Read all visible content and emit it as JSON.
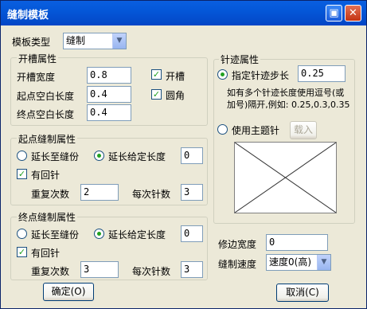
{
  "window": {
    "title": "缝制模板",
    "buttons": {
      "help": "▣",
      "close": "✕"
    }
  },
  "template_type": {
    "label": "模板类型",
    "value": "缝制"
  },
  "groove": {
    "title": "开槽属性",
    "width_label": "开槽宽度",
    "width_value": "0.8",
    "start_blank_label": "起点空白长度",
    "start_blank_value": "0.4",
    "end_blank_label": "终点空白长度",
    "end_blank_value": "0.4",
    "groove_check_label": "开槽",
    "round_check_label": "圆角"
  },
  "stitch": {
    "title": "针迹属性",
    "step_label": "指定针迹步长",
    "step_value": "0.25",
    "hint": "如有多个针迹长度使用逗号(或加号)隔开,例如: 0.25,0.3,0.35",
    "theme_label": "使用主题针",
    "import_button": "载入"
  },
  "start_sewing": {
    "title": "起点缝制属性",
    "extend_to_seam": "延长至缝份",
    "extend_given": "延长给定长度",
    "extend_value": "0",
    "backstitch_label": "有回针",
    "repeat_label": "重复次数",
    "repeat_value": "2",
    "per_label": "每次针数",
    "per_value": "3"
  },
  "end_sewing": {
    "title": "终点缝制属性",
    "extend_to_seam": "延长至缝份",
    "extend_given": "延长给定长度",
    "extend_value": "0",
    "backstitch_label": "有回针",
    "repeat_label": "重复次数",
    "repeat_value": "3",
    "per_label": "每次针数",
    "per_value": "3"
  },
  "trim": {
    "label": "修边宽度",
    "value": "0"
  },
  "speed": {
    "label": "缝制速度",
    "value": "速度0(高)"
  },
  "footer": {
    "ok": "确定(O)",
    "cancel": "取消(C)"
  }
}
